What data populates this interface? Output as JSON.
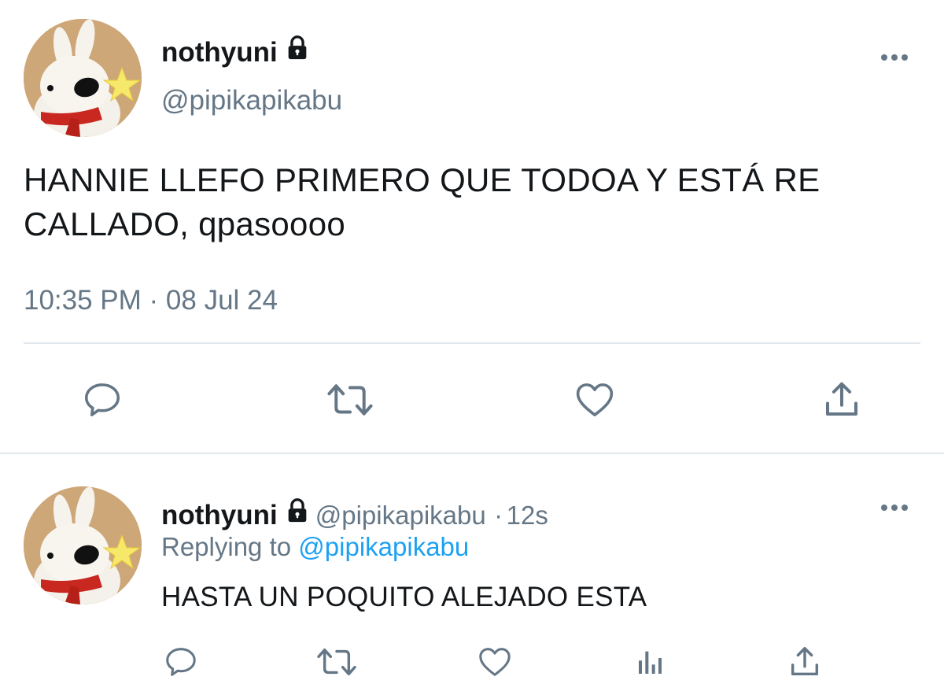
{
  "main_tweet": {
    "display_name": "nothyuni",
    "handle": "@pipikapikabu",
    "text": "HANNIE LLEFO PRIMERO QUE TODOA Y ESTÁ RE CALLADO, qpasoooo",
    "timestamp": "10:35 PM · 08 Jul 24",
    "icons": {
      "lock": "lock-icon",
      "more": "more-icon",
      "reply": "reply-icon",
      "retweet": "retweet-icon",
      "like": "heart-icon",
      "share": "share-icon"
    }
  },
  "reply_tweet": {
    "display_name": "nothyuni",
    "handle": "@pipikapikabu",
    "separator": "·",
    "time_ago": "12s",
    "replying_prefix": "Replying to",
    "replying_to": "@pipikapikabu",
    "text": "HASTA UN POQUITO ALEJADO ESTA",
    "icons": {
      "reply": "reply-icon",
      "retweet": "retweet-icon",
      "like": "heart-icon",
      "analytics": "analytics-icon",
      "share": "share-icon"
    }
  },
  "colors": {
    "text": "#14171a",
    "secondary": "#657786",
    "accent": "#1da1f2",
    "divider": "#e1e8ed"
  }
}
